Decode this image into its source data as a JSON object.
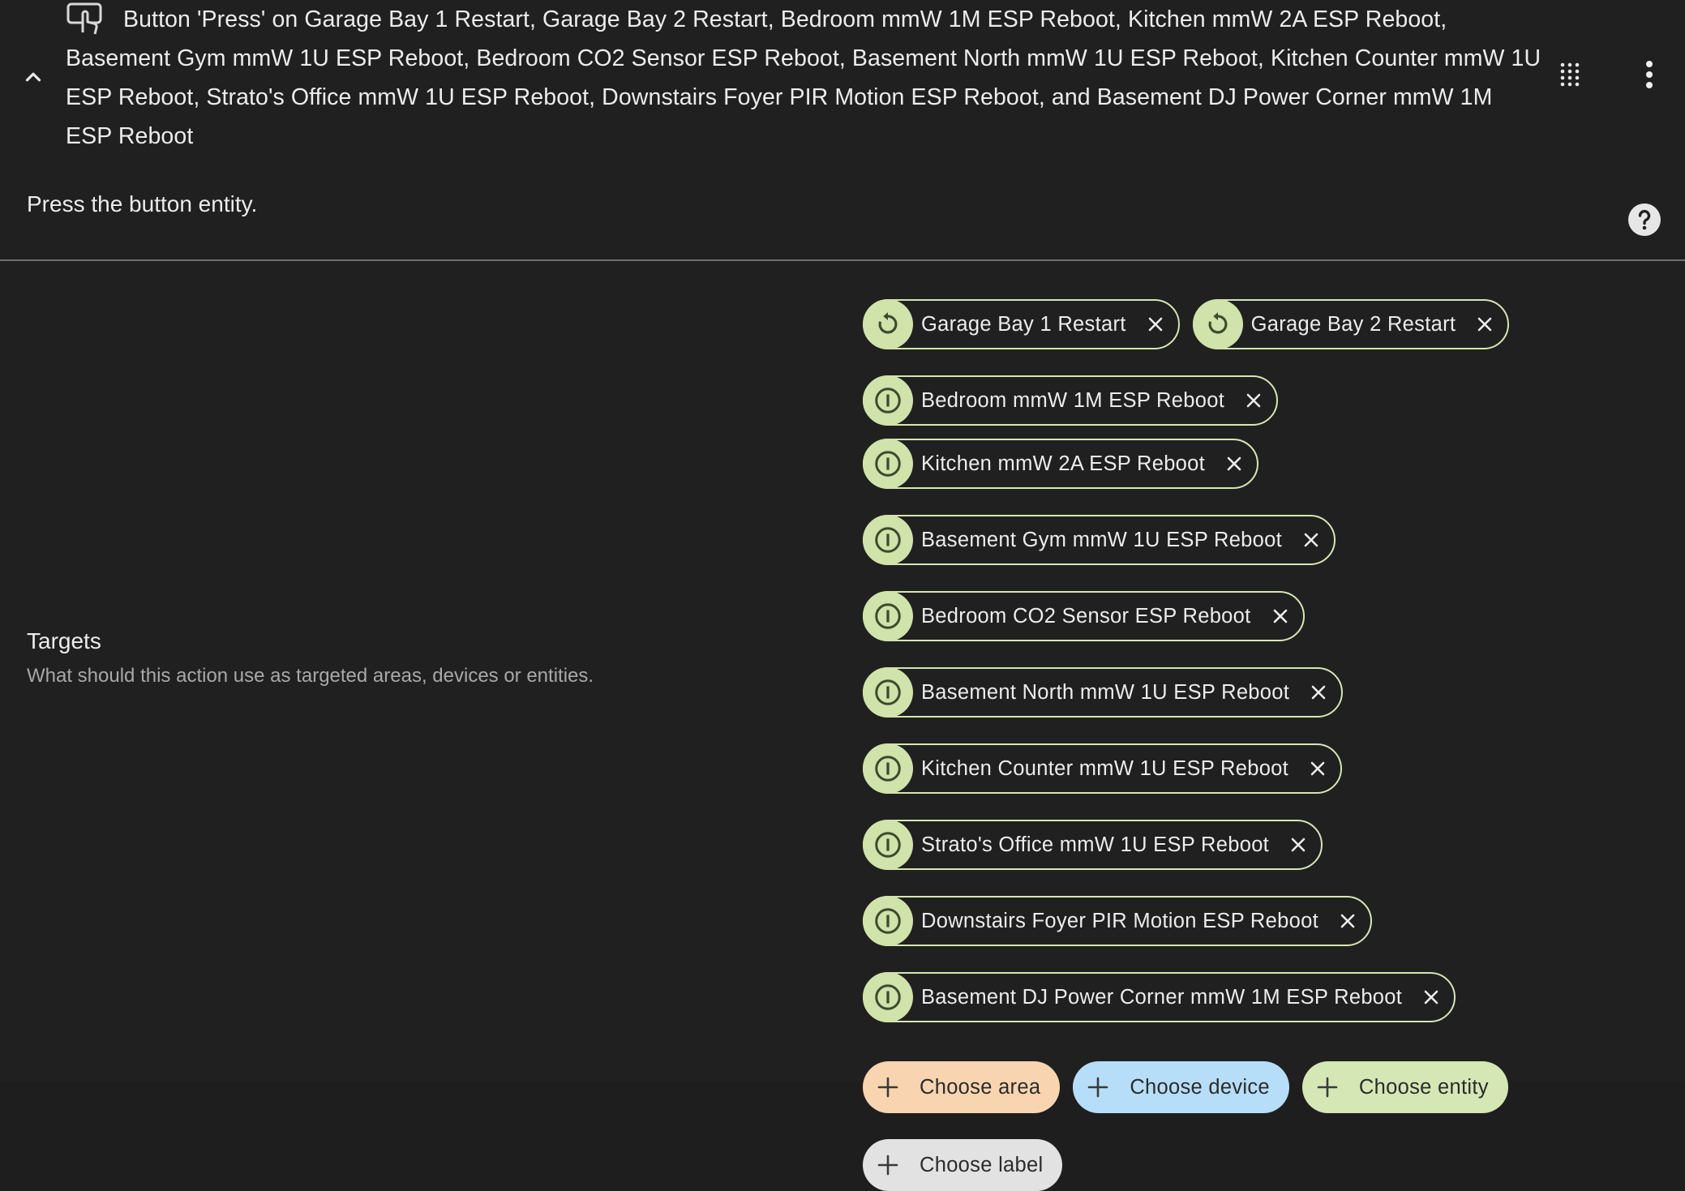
{
  "header": {
    "title": "Button 'Press' on Garage Bay 1 Restart, Garage Bay 2 Restart, Bedroom mmW 1M ESP Reboot, Kitchen mmW 2A ESP Reboot, Basement Gym mmW 1U ESP Reboot, Bedroom CO2 Sensor ESP Reboot, Basement North mmW 1U ESP Reboot, Kitchen Counter mmW 1U ESP Reboot, Strato's Office mmW 1U ESP Reboot, Downstairs Foyer PIR Motion ESP Reboot, and Basement DJ Power Corner mmW 1M ESP Reboot",
    "description": "Press the button entity.",
    "icons": {
      "collapse": "chevron-up-icon",
      "action": "gesture-tap-button-icon",
      "grid": "dots-grid-icon",
      "menu": "dots-vertical-icon",
      "help": "help-circle-icon"
    }
  },
  "targets": {
    "title": "Targets",
    "description": "What should this action use as targeted areas, devices or entities.",
    "chips": [
      {
        "label": "Garage Bay 1 Restart",
        "icon": "restart-icon"
      },
      {
        "label": "Garage Bay 2 Restart",
        "icon": "restart-icon"
      },
      {
        "label": "Bedroom mmW 1M ESP Reboot",
        "icon": "power-circle-icon"
      },
      {
        "label": "Kitchen mmW 2A ESP Reboot",
        "icon": "power-circle-icon"
      },
      {
        "label": "Basement Gym mmW 1U ESP Reboot",
        "icon": "power-circle-icon"
      },
      {
        "label": "Bedroom CO2 Sensor ESP Reboot",
        "icon": "power-circle-icon"
      },
      {
        "label": "Basement North mmW 1U ESP Reboot",
        "icon": "power-circle-icon"
      },
      {
        "label": "Kitchen Counter mmW 1U ESP Reboot",
        "icon": "power-circle-icon"
      },
      {
        "label": "Strato's Office mmW 1U ESP Reboot",
        "icon": "power-circle-icon"
      },
      {
        "label": "Downstairs Foyer PIR Motion ESP Reboot",
        "icon": "power-circle-icon"
      },
      {
        "label": "Basement DJ Power Corner mmW 1M ESP Reboot",
        "icon": "power-circle-icon"
      }
    ],
    "add_buttons": [
      {
        "label": "Choose area",
        "color": "#f8d5b0"
      },
      {
        "label": "Choose device",
        "color": "#b6def9"
      },
      {
        "label": "Choose entity",
        "color": "#d4e7b5"
      },
      {
        "label": "Choose label",
        "color": "#e2e2e2"
      }
    ]
  },
  "colors": {
    "background": "#202020",
    "chip_border": "#d6e6b4",
    "chip_avatar": "#cfe3aa",
    "text": "#ececec",
    "secondary_text": "#a8a8a8",
    "divider": "#6e6e6e"
  }
}
